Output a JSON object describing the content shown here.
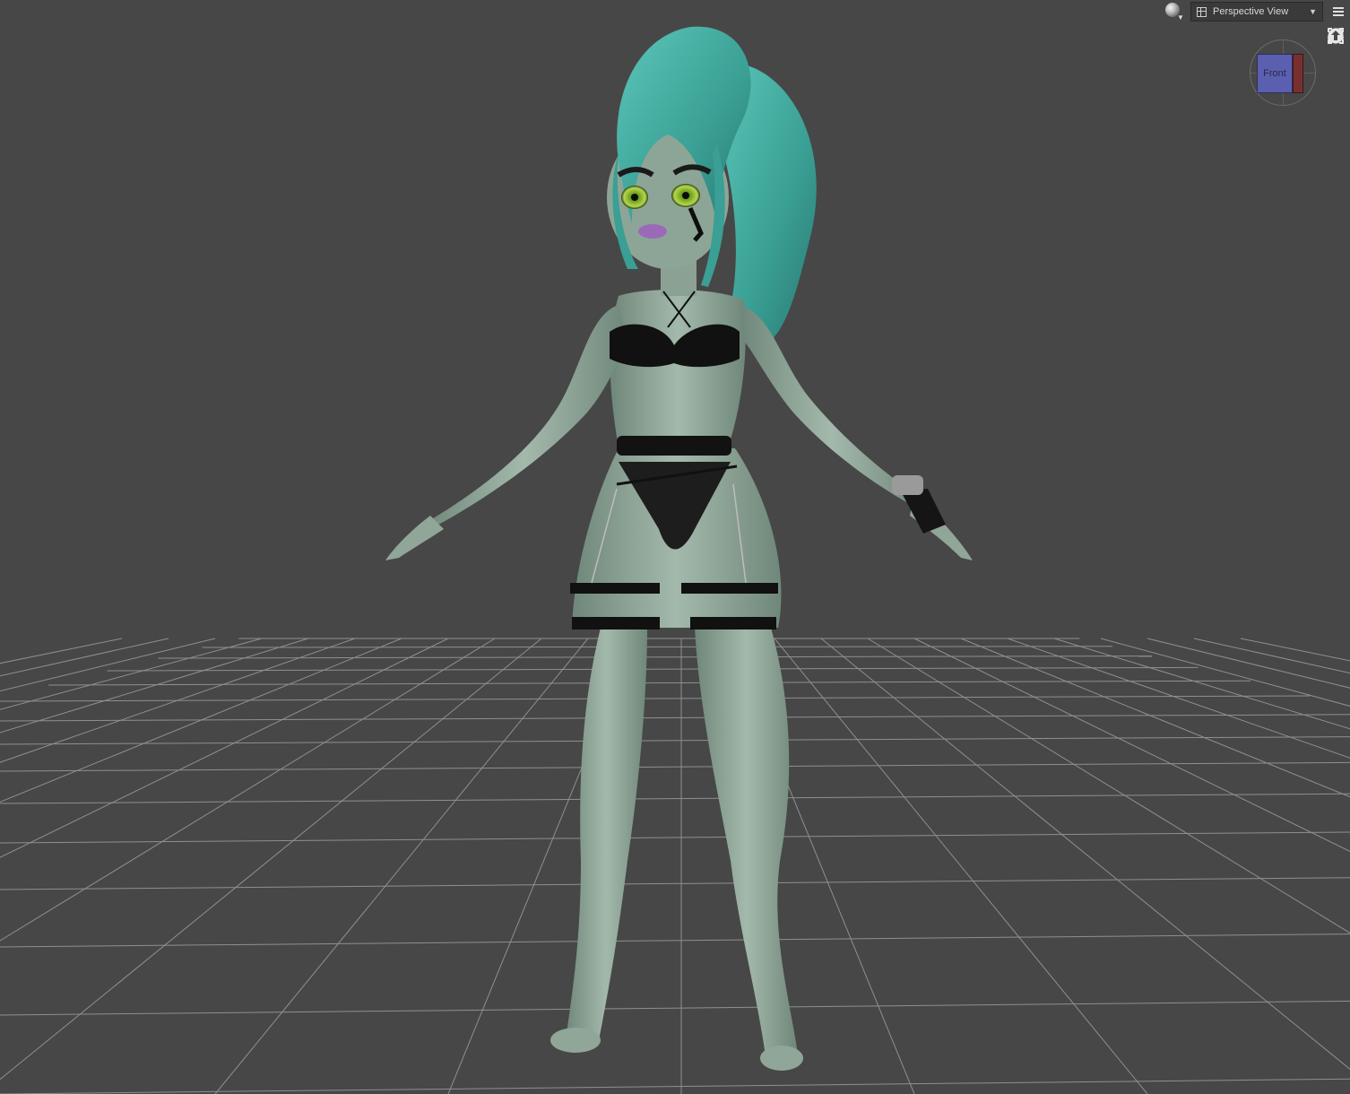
{
  "toolbar": {
    "view_label": "Perspective View",
    "render_icon": "render-sphere-icon",
    "dropdown_icon": "view-grid-icon",
    "menu_icon": "hamburger-menu-icon"
  },
  "view_cube": {
    "face_label": "Front",
    "face_color": "#5a5fb0",
    "side_color": "#7a2f2f"
  },
  "nav_tools": [
    {
      "name": "orbit-icon"
    },
    {
      "name": "pan-icon"
    },
    {
      "name": "zoom-icon"
    },
    {
      "name": "frame-icon"
    },
    {
      "name": "home-icon"
    }
  ],
  "colors": {
    "background": "#474747",
    "grid_line": "#a8a8a8",
    "skin": "#8da597",
    "hair": "#3fa79d",
    "garment": "#111111"
  }
}
